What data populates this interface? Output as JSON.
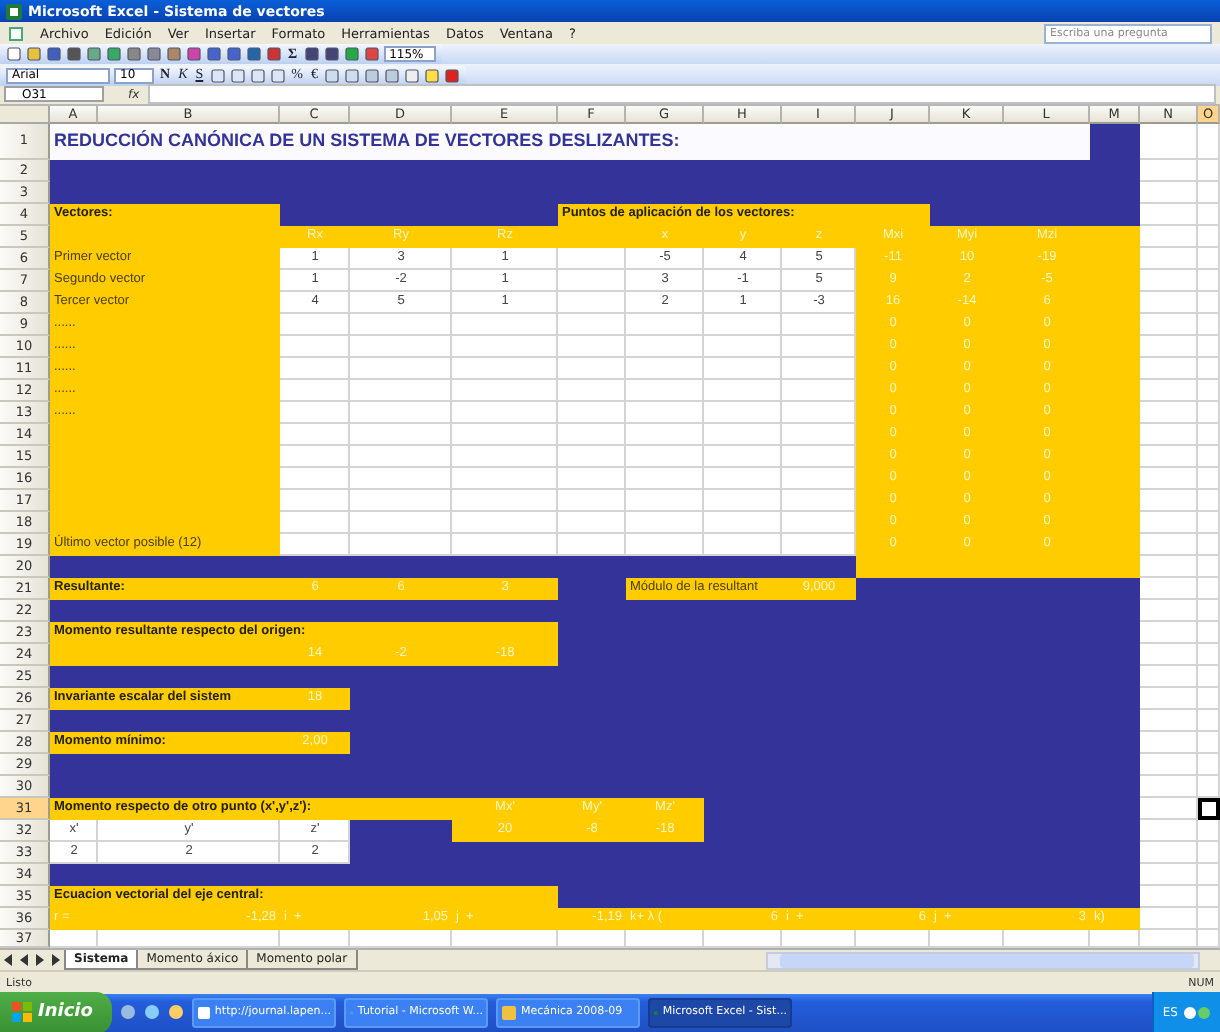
{
  "window": {
    "title": "Microsoft Excel - Sistema de vectores"
  },
  "menu": [
    {
      "label": "Archivo"
    },
    {
      "label": "Edición"
    },
    {
      "label": "Ver"
    },
    {
      "label": "Insertar"
    },
    {
      "label": "Formato"
    },
    {
      "label": "Herramientas"
    },
    {
      "label": "Datos"
    },
    {
      "label": "Ventana"
    },
    {
      "label": "?"
    }
  ],
  "help_box": {
    "placeholder": "Escriba una pregunta"
  },
  "toolbar": {
    "sum": "Σ",
    "zoom": "115%"
  },
  "format_toolbar": {
    "font": "Arial",
    "size": "10",
    "buttons": [
      {
        "label": "N"
      },
      {
        "label": "K"
      },
      {
        "label": "S"
      },
      {
        "label": "%"
      },
      {
        "label": "€"
      }
    ]
  },
  "formula_bar": {
    "name_box": "O31",
    "fx": "fx"
  },
  "columns": [
    {
      "label": "A",
      "selected": false
    },
    {
      "label": "B",
      "selected": false
    },
    {
      "label": "C",
      "selected": false
    },
    {
      "label": "D",
      "selected": false
    },
    {
      "label": "E",
      "selected": false
    },
    {
      "label": "F",
      "selected": false
    },
    {
      "label": "G",
      "selected": false
    },
    {
      "label": "H",
      "selected": false
    },
    {
      "label": "I",
      "selected": false
    },
    {
      "label": "J",
      "selected": false
    },
    {
      "label": "K",
      "selected": false
    },
    {
      "label": "L",
      "selected": false
    },
    {
      "label": "M",
      "selected": false
    },
    {
      "label": "N",
      "selected": false
    },
    {
      "label": "O",
      "selected": true
    }
  ],
  "rows": [
    {
      "number": "1",
      "selected": false,
      "cells": [
        {
          "kind": "title",
          "text": "REDUCCIÓN CANÓNICA DE UN SISTEMA DE VECTORES DESLIZANTES:"
        }
      ]
    },
    {
      "number": "2",
      "selected": false
    },
    {
      "number": "3",
      "selected": false
    },
    {
      "number": "4",
      "selected": false,
      "cells": [
        {
          "kind": "heading",
          "text": "Vectores:"
        },
        {
          "kind": "heading",
          "text": "Puntos de aplicación de los vectores:"
        }
      ]
    },
    {
      "number": "5",
      "selected": false,
      "cells": [
        {
          "kind": "number",
          "text": "Rx"
        },
        {
          "kind": "number",
          "text": "Ry"
        },
        {
          "kind": "number",
          "text": "Rz"
        },
        {
          "kind": "number",
          "text": "x"
        },
        {
          "kind": "number",
          "text": "y"
        },
        {
          "kind": "number",
          "text": "z"
        },
        {
          "kind": "number",
          "text": "Mxi"
        },
        {
          "kind": "number",
          "text": "Myi"
        },
        {
          "kind": "number",
          "text": "Mzi"
        }
      ]
    },
    {
      "number": "6",
      "selected": false,
      "cells": [
        {
          "kind": "label",
          "text": "Primer vector"
        },
        {
          "kind": "number",
          "text": "1"
        },
        {
          "kind": "number",
          "text": "3"
        },
        {
          "kind": "number",
          "text": "1"
        },
        {
          "kind": "number",
          "text": "-5"
        },
        {
          "kind": "number",
          "text": "4"
        },
        {
          "kind": "number",
          "text": "5"
        },
        {
          "kind": "number",
          "text": "-11"
        },
        {
          "kind": "number",
          "text": "10"
        },
        {
          "kind": "number",
          "text": "-19"
        }
      ]
    },
    {
      "number": "7",
      "selected": false,
      "cells": [
        {
          "kind": "label",
          "text": "Segundo vector"
        },
        {
          "kind": "number",
          "text": "1"
        },
        {
          "kind": "number",
          "text": "-2"
        },
        {
          "kind": "number",
          "text": "1"
        },
        {
          "kind": "number",
          "text": "3"
        },
        {
          "kind": "number",
          "text": "-1"
        },
        {
          "kind": "number",
          "text": "5"
        },
        {
          "kind": "number",
          "text": "9"
        },
        {
          "kind": "number",
          "text": "2"
        },
        {
          "kind": "number",
          "text": "-5"
        }
      ]
    },
    {
      "number": "8",
      "selected": false,
      "cells": [
        {
          "kind": "label",
          "text": "Tercer vector"
        },
        {
          "kind": "number",
          "text": "4"
        },
        {
          "kind": "number",
          "text": "5"
        },
        {
          "kind": "number",
          "text": "1"
        },
        {
          "kind": "number",
          "text": "2"
        },
        {
          "kind": "number",
          "text": "1"
        },
        {
          "kind": "number",
          "text": "-3"
        },
        {
          "kind": "number",
          "text": "16"
        },
        {
          "kind": "number",
          "text": "-14"
        },
        {
          "kind": "number",
          "text": "6"
        }
      ]
    },
    {
      "number": "9",
      "selected": false,
      "cells": [
        {
          "kind": "label",
          "text": "......"
        },
        {
          "kind": "number",
          "text": "0"
        },
        {
          "kind": "number",
          "text": "0"
        },
        {
          "kind": "number",
          "text": "0"
        }
      ]
    },
    {
      "number": "10",
      "selected": false,
      "cells": [
        {
          "kind": "label",
          "text": "......"
        },
        {
          "kind": "number",
          "text": "0"
        },
        {
          "kind": "number",
          "text": "0"
        },
        {
          "kind": "number",
          "text": "0"
        }
      ]
    },
    {
      "number": "11",
      "selected": false,
      "cells": [
        {
          "kind": "label",
          "text": "......"
        },
        {
          "kind": "number",
          "text": "0"
        },
        {
          "kind": "number",
          "text": "0"
        },
        {
          "kind": "number",
          "text": "0"
        }
      ]
    },
    {
      "number": "12",
      "selected": false,
      "cells": [
        {
          "kind": "label",
          "text": "......"
        },
        {
          "kind": "number",
          "text": "0"
        },
        {
          "kind": "number",
          "text": "0"
        },
        {
          "kind": "number",
          "text": "0"
        }
      ]
    },
    {
      "number": "13",
      "selected": false,
      "cells": [
        {
          "kind": "label",
          "text": "......"
        },
        {
          "kind": "number",
          "text": "0"
        },
        {
          "kind": "number",
          "text": "0"
        },
        {
          "kind": "number",
          "text": "0"
        }
      ]
    },
    {
      "number": "14",
      "selected": false,
      "cells": [
        {
          "kind": "number",
          "text": "0"
        },
        {
          "kind": "number",
          "text": "0"
        },
        {
          "kind": "number",
          "text": "0"
        }
      ]
    },
    {
      "number": "15",
      "selected": false,
      "cells": [
        {
          "kind": "number",
          "text": "0"
        },
        {
          "kind": "number",
          "text": "0"
        },
        {
          "kind": "number",
          "text": "0"
        }
      ]
    },
    {
      "number": "16",
      "selected": false,
      "cells": [
        {
          "kind": "number",
          "text": "0"
        },
        {
          "kind": "number",
          "text": "0"
        },
        {
          "kind": "number",
          "text": "0"
        }
      ]
    },
    {
      "number": "17",
      "selected": false,
      "cells": [
        {
          "kind": "number",
          "text": "0"
        },
        {
          "kind": "number",
          "text": "0"
        },
        {
          "kind": "number",
          "text": "0"
        }
      ]
    },
    {
      "number": "18",
      "selected": false,
      "cells": [
        {
          "kind": "number",
          "text": "0"
        },
        {
          "kind": "number",
          "text": "0"
        },
        {
          "kind": "number",
          "text": "0"
        }
      ]
    },
    {
      "number": "19",
      "selected": false,
      "cells": [
        {
          "kind": "label",
          "text": "Último vector posible (12)"
        },
        {
          "kind": "number",
          "text": "0"
        },
        {
          "kind": "number",
          "text": "0"
        },
        {
          "kind": "number",
          "text": "0"
        }
      ]
    },
    {
      "number": "20",
      "selected": false
    },
    {
      "number": "21",
      "selected": false,
      "cells": [
        {
          "kind": "heading",
          "text": "Resultante:"
        },
        {
          "kind": "number",
          "text": "6"
        },
        {
          "kind": "number",
          "text": "6"
        },
        {
          "kind": "number",
          "text": "3"
        },
        {
          "kind": "label",
          "text": "Módulo de la resultant"
        },
        {
          "kind": "number",
          "text": "9,000"
        }
      ]
    },
    {
      "number": "22",
      "selected": false
    },
    {
      "number": "23",
      "selected": false,
      "cells": [
        {
          "kind": "heading",
          "text": "Momento resultante respecto del origen:"
        }
      ]
    },
    {
      "number": "24",
      "selected": false,
      "cells": [
        {
          "kind": "number",
          "text": "14"
        },
        {
          "kind": "number",
          "text": "-2"
        },
        {
          "kind": "number",
          "text": "-18"
        }
      ]
    },
    {
      "number": "25",
      "selected": false
    },
    {
      "number": "26",
      "selected": false,
      "cells": [
        {
          "kind": "heading",
          "text": "Invariante escalar del sistem"
        },
        {
          "kind": "number",
          "text": "18"
        }
      ]
    },
    {
      "number": "27",
      "selected": false
    },
    {
      "number": "28",
      "selected": false,
      "cells": [
        {
          "kind": "heading",
          "text": "Momento mínimo:"
        },
        {
          "kind": "number",
          "text": "2,00"
        }
      ]
    },
    {
      "number": "29",
      "selected": false
    },
    {
      "number": "30",
      "selected": false
    },
    {
      "number": "31",
      "selected": true,
      "cells": [
        {
          "kind": "heading",
          "text": "Momento respecto de otro punto (x',y',z'):"
        },
        {
          "kind": "number",
          "text": "Mx'"
        },
        {
          "kind": "number",
          "text": "My'"
        },
        {
          "kind": "number",
          "text": "Mz'"
        }
      ]
    },
    {
      "number": "32",
      "selected": false,
      "cells": [
        {
          "kind": "number",
          "text": "x'"
        },
        {
          "kind": "number",
          "text": "y'"
        },
        {
          "kind": "number",
          "text": "z'"
        },
        {
          "kind": "number",
          "text": "20"
        },
        {
          "kind": "number",
          "text": "-8"
        },
        {
          "kind": "number",
          "text": "-18"
        }
      ]
    },
    {
      "number": "33",
      "selected": false,
      "cells": [
        {
          "kind": "number",
          "text": "2"
        },
        {
          "kind": "number",
          "text": "2"
        },
        {
          "kind": "number",
          "text": "2"
        }
      ]
    },
    {
      "number": "34",
      "selected": false
    },
    {
      "number": "35",
      "selected": false,
      "cells": [
        {
          "kind": "heading",
          "text": "Ecuacion vectorial del eje central:"
        }
      ]
    },
    {
      "number": "36",
      "selected": false,
      "cells": [
        {
          "kind": "term",
          "text": "r ="
        },
        {
          "kind": "amount",
          "text": "-1,28"
        },
        {
          "kind": "term",
          "text": "i  +"
        },
        {
          "kind": "amount",
          "text": "1,05"
        },
        {
          "kind": "term",
          "text": "j  +"
        },
        {
          "kind": "amount",
          "text": "-1,19"
        },
        {
          "kind": "term",
          "text": "k+ λ ("
        },
        {
          "kind": "amount",
          "text": "6"
        },
        {
          "kind": "term",
          "text": "i  +"
        },
        {
          "kind": "amount",
          "text": "6"
        },
        {
          "kind": "term",
          "text": "j  +"
        },
        {
          "kind": "amount",
          "text": "3"
        },
        {
          "kind": "term",
          "text": "k)"
        }
      ]
    },
    {
      "number": "37",
      "selected": false
    }
  ],
  "sheet_tabs": [
    {
      "label": "Sistema",
      "selected": true
    },
    {
      "label": "Momento áxico",
      "selected": false
    },
    {
      "label": "Momento polar",
      "selected": false
    }
  ],
  "status_bar": {
    "text": "Listo",
    "indicator": "NUM"
  },
  "taskbar": {
    "start": "Inicio",
    "buttons": [
      {
        "label": "http://journal.lapen...",
        "selected": false
      },
      {
        "label": "Tutorial - Microsoft W...",
        "selected": false
      },
      {
        "label": "Mecánica 2008-09",
        "selected": false
      },
      {
        "label": "Microsoft Excel - Sist...",
        "selected": true
      }
    ],
    "tray": "ES"
  }
}
